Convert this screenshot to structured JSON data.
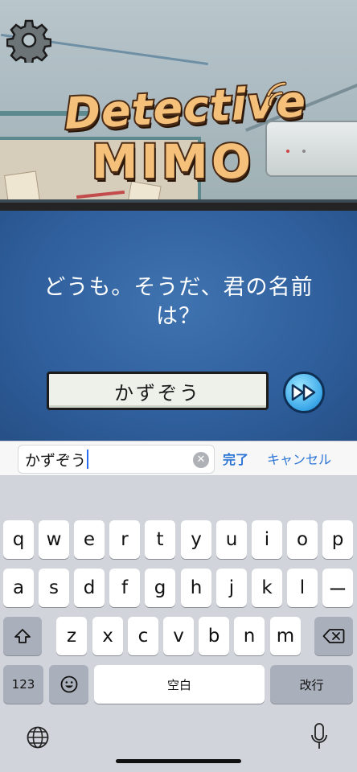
{
  "logo": {
    "line1": "Detective",
    "line2": "MIMO"
  },
  "dialog": {
    "prompt_line1": "どうも。そうだ、君の名前",
    "prompt_line2": "は？",
    "name_value": "かずぞう"
  },
  "input_bar": {
    "field_value": "かずぞう",
    "clear_symbol": "✕",
    "done_label": "完了",
    "cancel_label": "キャンセル"
  },
  "keyboard": {
    "row1": [
      "q",
      "w",
      "e",
      "r",
      "t",
      "y",
      "u",
      "i",
      "o",
      "p"
    ],
    "row2": [
      "a",
      "s",
      "d",
      "f",
      "g",
      "h",
      "j",
      "k",
      "l",
      "ー"
    ],
    "row3": [
      "z",
      "x",
      "c",
      "v",
      "b",
      "n",
      "m"
    ],
    "numbers_label": "123",
    "space_label": "空白",
    "return_label": "改行"
  },
  "colors": {
    "dialog_blue": "#2f5f9c",
    "link_blue": "#2b74d6",
    "logo_orange": "#f4c07a"
  },
  "icons": {
    "settings": "gear-icon",
    "fast_forward": "fast-forward-icon",
    "shift": "shift-icon",
    "delete": "backspace-icon",
    "emoji": "emoji-icon",
    "globe": "globe-icon",
    "mic": "microphone-icon"
  }
}
